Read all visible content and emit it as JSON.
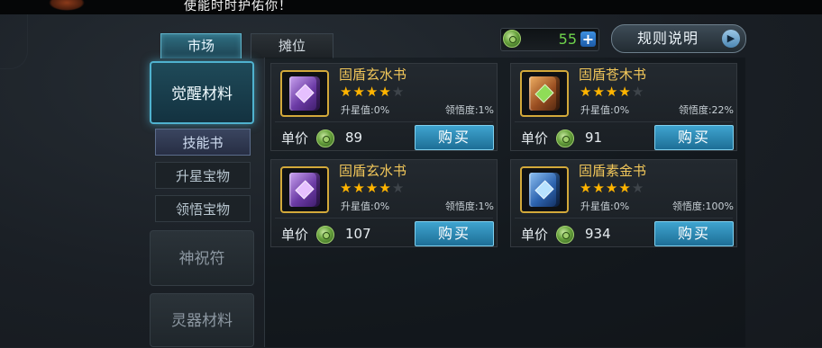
{
  "top_notice": "使能时时护佑你！",
  "tabs": [
    {
      "label": "市场",
      "active": true
    },
    {
      "label": "摊位",
      "active": false
    }
  ],
  "currency": {
    "icon": "jade-coin-icon",
    "amount": "55",
    "add_label": "+"
  },
  "rules_button": {
    "label": "规则说明",
    "icon": "play-arrow-icon"
  },
  "sidebar": {
    "categories": [
      {
        "label": "觉醒材料",
        "active": true
      },
      {
        "label": "神祝符",
        "active": false
      },
      {
        "label": "灵器材料",
        "active": false
      }
    ],
    "subcategories": [
      {
        "label": "技能书",
        "active": true
      },
      {
        "label": "升星宝物",
        "active": false
      },
      {
        "label": "领悟宝物",
        "active": false
      }
    ]
  },
  "items": [
    {
      "name": "固盾玄水书",
      "stars_filled": 4,
      "stars_total": 5,
      "upstar": "升星值:0%",
      "comprehension": "领悟度:1%",
      "price_label": "单价",
      "price": "89",
      "buy_label": "购买",
      "book_color": "purple"
    },
    {
      "name": "固盾苍木书",
      "stars_filled": 4,
      "stars_total": 5,
      "upstar": "升星值:0%",
      "comprehension": "领悟度:22%",
      "price_label": "单价",
      "price": "91",
      "buy_label": "购买",
      "book_color": "orange"
    },
    {
      "name": "固盾玄水书",
      "stars_filled": 4,
      "stars_total": 5,
      "upstar": "升星值:0%",
      "comprehension": "领悟度:1%",
      "price_label": "单价",
      "price": "107",
      "buy_label": "购买",
      "book_color": "purple"
    },
    {
      "name": "固盾素金书",
      "stars_filled": 4,
      "stars_total": 5,
      "upstar": "升星值:0%",
      "comprehension": "领悟度:100%",
      "price_label": "单价",
      "price": "934",
      "buy_label": "购买",
      "book_color": "blue"
    }
  ],
  "colors": {
    "accent_cyan": "#4fb2cf",
    "item_name": "#f2c75a",
    "star": "#ffb400",
    "currency_text": "#6fd34c",
    "buy_button": "#3fa4cf"
  }
}
